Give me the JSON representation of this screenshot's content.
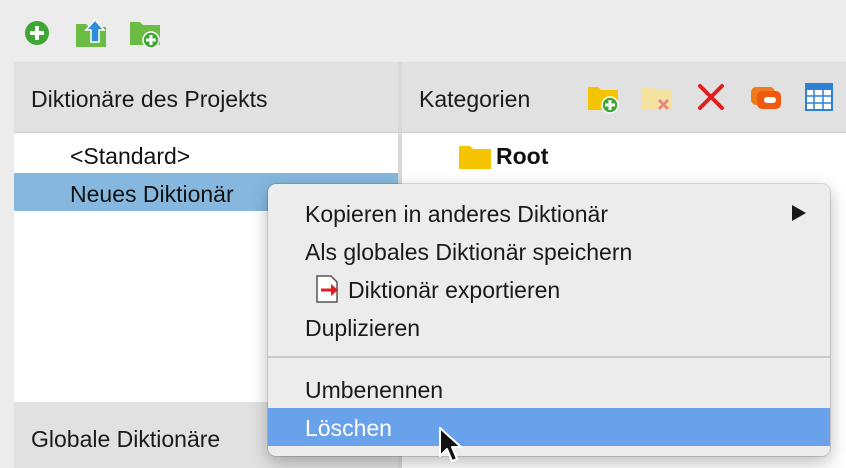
{
  "toolbar": {
    "buttons": [
      {
        "icon": "add-circle-icon",
        "color": "#3fa535"
      },
      {
        "icon": "upload-folder-icon",
        "color": "#6cbb45"
      },
      {
        "icon": "new-folder-icon",
        "color": "#6cbb45"
      }
    ]
  },
  "left_pane": {
    "title": "Diktionäre des Projekts",
    "items": [
      {
        "label": "<Standard>",
        "selected": false
      },
      {
        "label": "Neues Diktionär",
        "selected": true
      }
    ],
    "global_title": "Globale Diktionäre"
  },
  "right_pane": {
    "title": "Kategorien",
    "icons": [
      "new-category-icon",
      "delete-category-icon",
      "delete-icon",
      "toggle-icon",
      "table-icon"
    ],
    "tree": {
      "root_label": "Root"
    }
  },
  "context_menu": {
    "items": [
      {
        "label": "Kopieren in anderes Diktionär",
        "submenu": true
      },
      {
        "label": "Als globales Diktionär speichern"
      },
      {
        "label": "Diktionär exportieren",
        "icon": "export-icon"
      },
      {
        "label": "Duplizieren"
      },
      {
        "label": "Umbenennen"
      },
      {
        "label": "Löschen",
        "highlighted": true
      }
    ]
  },
  "colors": {
    "selection": "#86b8df",
    "menu_highlight": "#69a1ea",
    "folder": "#f5c400",
    "delete_red": "#e02020",
    "accent_green": "#3fa535"
  }
}
